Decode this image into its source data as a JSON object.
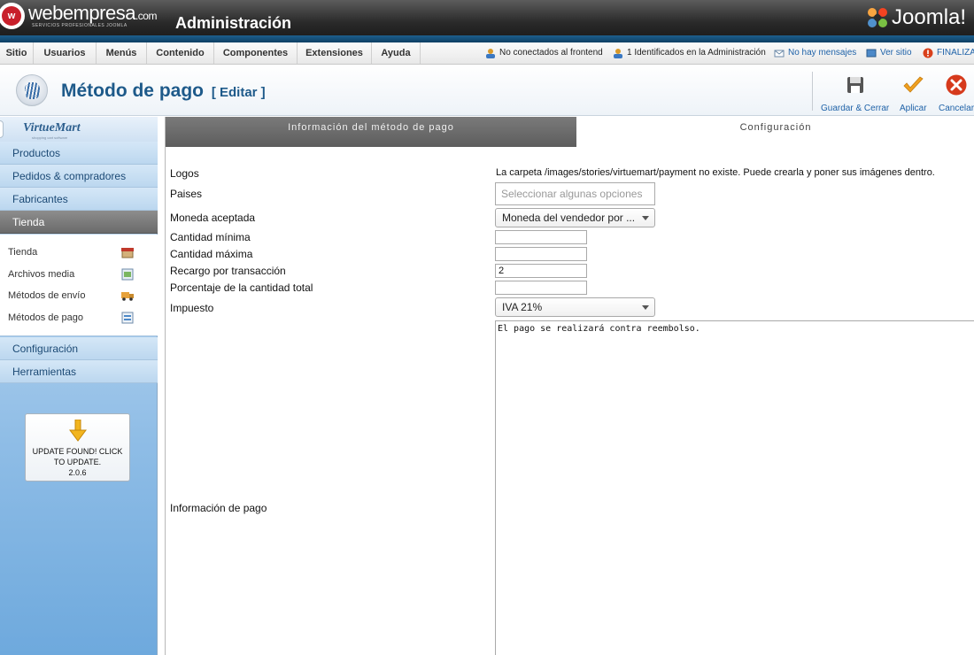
{
  "header": {
    "brand_name": "webempresa",
    "brand_suffix": ".com",
    "brand_tagline": "SERVICIOS PROFESIONALES JOOMLA",
    "brand_mark": "w",
    "admin_title": "Administración",
    "joomla_logo_text": "Joomla!"
  },
  "menu": {
    "items": [
      "Sitio",
      "Usuarios",
      "Menús",
      "Contenido",
      "Componentes",
      "Extensiones",
      "Ayuda"
    ]
  },
  "status": {
    "frontend": "No conectados al frontend",
    "admin": "1 Identificados en la Administración",
    "messages": "No hay mensajes",
    "view_site": "Ver sitio",
    "logout": "FINALIZA"
  },
  "toolbar": {
    "title": "Método de pago",
    "edit": "[ Editar ]",
    "save_close": "Guardar & Cerrar",
    "apply": "Aplicar",
    "cancel": "Cancelar"
  },
  "sidebar": {
    "logo_text": "VirtueMart",
    "logo_sub": "shopping cart software",
    "categories": [
      "Productos",
      "Pedidos & compradores",
      "Fabricantes",
      "Tienda"
    ],
    "active_category": "Tienda",
    "sub_items": [
      "Tienda",
      "Archivos media",
      "Métodos de envío",
      "Métodos de pago"
    ],
    "bottom_categories": [
      "Configuración",
      "Herramientas"
    ],
    "update": {
      "line1": "UPDATE FOUND! CLICK",
      "line2": "TO UPDATE.",
      "version": "2.0.6"
    }
  },
  "tabs": {
    "info": "Información del método de pago",
    "config": "Configuración"
  },
  "form": {
    "logos_label": "Logos",
    "logos_value": "La carpeta /images/stories/virtuemart/payment no existe. Puede crearla y poner sus imágenes dentro.",
    "paises_label": "Paises",
    "paises_placeholder": "Seleccionar algunas opciones",
    "moneda_label": "Moneda aceptada",
    "moneda_value": "Moneda del vendedor por ...",
    "cantidad_minima_label": "Cantidad mínima",
    "cantidad_minima_value": "",
    "cantidad_maxima_label": "Cantidad máxima",
    "cantidad_maxima_value": "",
    "recargo_label": "Recargo por transacción",
    "recargo_value": "2",
    "porcentaje_label": "Porcentaje de la cantidad total",
    "porcentaje_value": "",
    "impuesto_label": "Impuesto",
    "impuesto_value": "IVA 21%",
    "info_pago_label": "Información de pago",
    "info_pago_value": "El pago se realizará contra reembolso."
  },
  "colors": {
    "accent_blue": "#1e5a8a",
    "link_blue": "#1f62a8",
    "header_dark": "#2a2a2a",
    "brand_red": "#c8202b",
    "apply_orange": "#f0a020",
    "cancel_red": "#d63a1c"
  },
  "icons": {
    "menu_status": [
      "users-icon",
      "admin-users-icon",
      "messages-icon",
      "view-site-icon",
      "logout-icon"
    ],
    "toolbar": [
      "save-icon",
      "apply-check-icon",
      "cancel-x-icon"
    ],
    "sidebar_sub": [
      "store-icon",
      "media-files-icon",
      "shipping-truck-icon",
      "payment-methods-icon"
    ],
    "update": "download-arrow-icon"
  }
}
